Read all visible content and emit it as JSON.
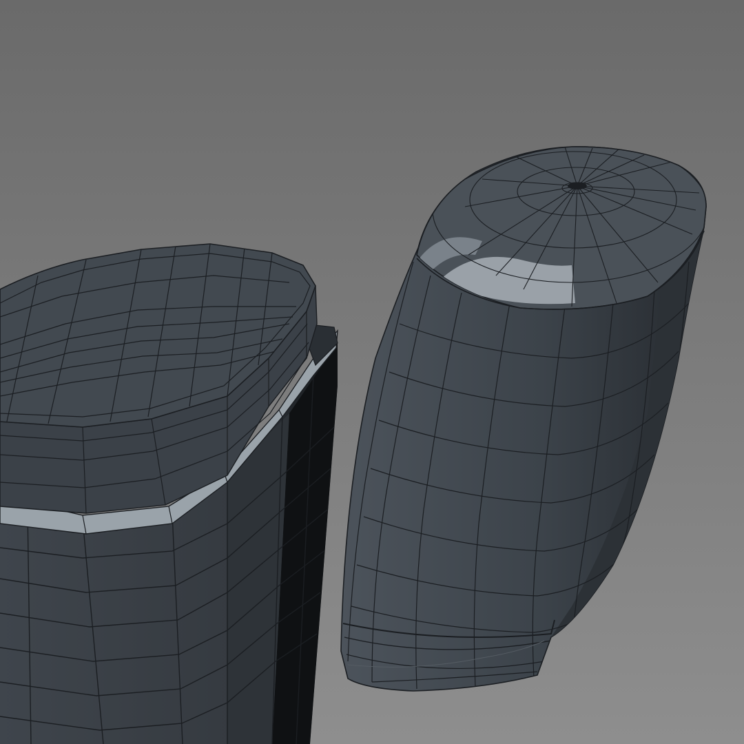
{
  "scene": {
    "background_top": "#6a6a6a",
    "background_bottom": "#8e8e8e",
    "wire_color": "#1b1e22",
    "objects": [
      {
        "name": "jar-with-lid",
        "body_color": "#3a4047",
        "highlight_band": "#9aa3aa"
      },
      {
        "name": "capsule-bottle",
        "body_color": "#434a52",
        "highlight_band": "#9aa1a8"
      }
    ]
  }
}
